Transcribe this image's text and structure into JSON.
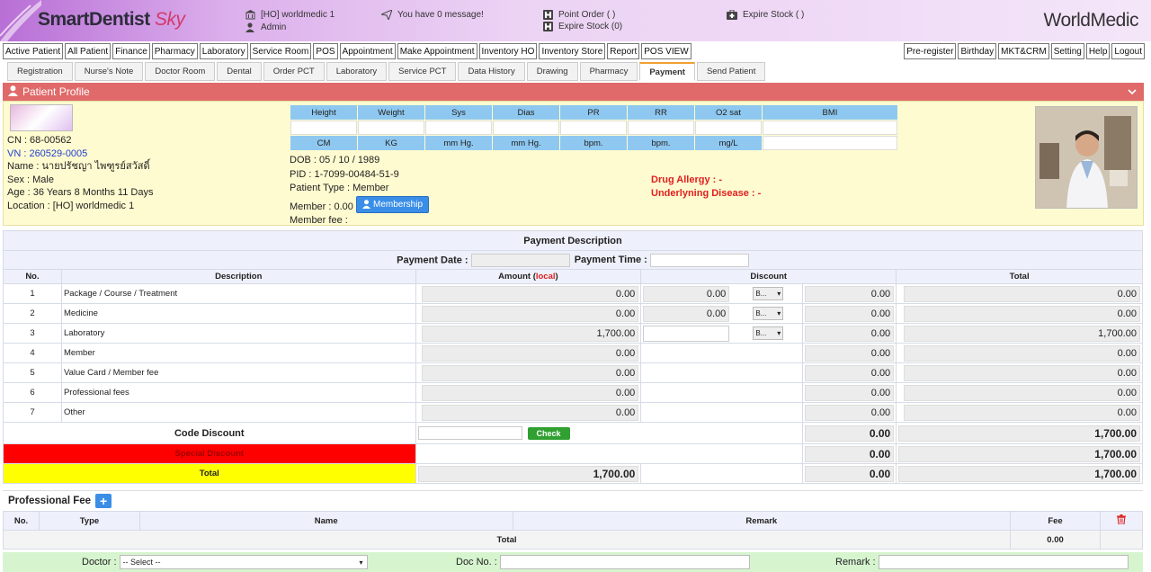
{
  "header": {
    "brand_main": "SmartDentist",
    "brand_sky": "Sky",
    "branch": "[HO] worldmedic 1",
    "user": "Admin",
    "messages": "You have 0 message!",
    "point_order": "Point Order ( )",
    "expire_stock_paren": "Expire Stock (0)",
    "expire_stock": "Expire Stock ( )",
    "company": "WorldMedic"
  },
  "menu": {
    "left": [
      "Active Patient",
      "All Patient",
      "Finance",
      "Pharmacy",
      "Laboratory",
      "Service Room",
      "POS",
      "Appointment",
      "Make Appointment",
      "Inventory HO",
      "Inventory Store",
      "Report",
      "POS VIEW"
    ],
    "right": [
      "Pre-register",
      "Birthday",
      "MKT&CRM",
      "Setting",
      "Help",
      "Logout"
    ]
  },
  "tabs": [
    "Registration",
    "Nurse's Note",
    "Doctor Room",
    "Dental",
    "Order PCT",
    "Laboratory",
    "Service PCT",
    "Data History",
    "Drawing",
    "Pharmacy",
    "Payment",
    "Send Patient"
  ],
  "profile": {
    "title": "Patient Profile",
    "cn": "CN : 68-00562",
    "vn": "VN : 260529-0005",
    "name": "Name : นายปรัชญา ไพฑูรย์สวัสดิ์",
    "sex": "Sex : Male",
    "age": "Age : 36 Years 8 Months 11 Days",
    "location": "Location : [HO] worldmedic 1",
    "dob": "DOB : 05 / 10 / 1989",
    "pid": "PID : 1-7099-00484-51-9",
    "patient_type": "Patient Type : Member",
    "member": "Member : 0.00",
    "membership_btn": "Membership",
    "member_fee": "Member fee :",
    "drug_allergy": "Drug Allergy : -",
    "underlying": "Underlyning Disease : -"
  },
  "vitals": {
    "headers": [
      "Height",
      "Weight",
      "Sys",
      "Dias",
      "PR",
      "RR",
      "O2 sat",
      "BMI"
    ],
    "units": [
      "CM",
      "KG",
      "mm Hg.",
      "mm Hg.",
      "bpm.",
      "bpm.",
      "mg/L"
    ]
  },
  "payment": {
    "title": "Payment Description",
    "date_label": "Payment Date :",
    "time_label": "Payment Time :",
    "col_no": "No.",
    "col_desc": "Description",
    "col_amount": "Amount (",
    "col_amount_local": "local",
    "col_amount_end": ")",
    "col_discount": "Discount",
    "col_total": "Total",
    "rows": [
      {
        "no": "1",
        "desc": "Package / Course / Treatment",
        "amount": "0.00",
        "disc": "0.00",
        "sel": "B...",
        "disc_total": "0.00",
        "total": "0.00"
      },
      {
        "no": "2",
        "desc": "Medicine",
        "amount": "0.00",
        "disc": "0.00",
        "sel": "B...",
        "disc_total": "0.00",
        "total": "0.00"
      },
      {
        "no": "3",
        "desc": "Laboratory",
        "amount": "1,700.00",
        "disc": "",
        "sel": "B...",
        "disc_total": "0.00",
        "total": "1,700.00"
      },
      {
        "no": "4",
        "desc": "Member",
        "amount": "0.00",
        "disc_total": "0.00",
        "total": "0.00"
      },
      {
        "no": "5",
        "desc": "Value Card / Member fee",
        "amount": "0.00",
        "disc_total": "0.00",
        "total": "0.00"
      },
      {
        "no": "6",
        "desc": "Professional fees",
        "amount": "0.00",
        "disc_total": "0.00",
        "total": "0.00"
      },
      {
        "no": "7",
        "desc": "Other",
        "amount": "0.00",
        "disc_total": "0.00",
        "total": "0.00"
      }
    ],
    "code_discount": "Code Discount",
    "check_btn": "Check",
    "code_disc_total": "0.00",
    "code_total": "1,700.00",
    "special_discount": "Special Discount",
    "special_disc_total": "0.00",
    "special_total": "1,700.00",
    "total_label": "Total",
    "total_amount": "1,700.00",
    "total_disc": "0.00",
    "grand_total": "1,700.00"
  },
  "profee": {
    "title": "Professional Fee",
    "headers": [
      "No.",
      "Type",
      "Name",
      "Remark",
      "Fee"
    ],
    "total_label": "Total",
    "total_value": "0.00"
  },
  "doctor_bar": {
    "doctor_label": "Doctor :",
    "doctor_select": "-- Select --",
    "doc_no_label": "Doc No. :",
    "remark_label": "Remark :"
  }
}
